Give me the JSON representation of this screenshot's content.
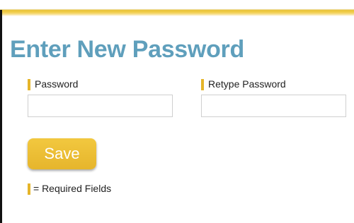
{
  "page": {
    "title": "Enter New Password"
  },
  "form": {
    "password": {
      "label": "Password",
      "value": "",
      "placeholder": ""
    },
    "retype_password": {
      "label": "Retype Password",
      "value": "",
      "placeholder": ""
    },
    "save_label": "Save",
    "required_legend": "= Required Fields"
  },
  "colors": {
    "accent": "#e8b930",
    "title": "#5f9fbc",
    "button_text": "#ffffff"
  },
  "icons": {
    "required_marker": "required-marker-icon"
  }
}
